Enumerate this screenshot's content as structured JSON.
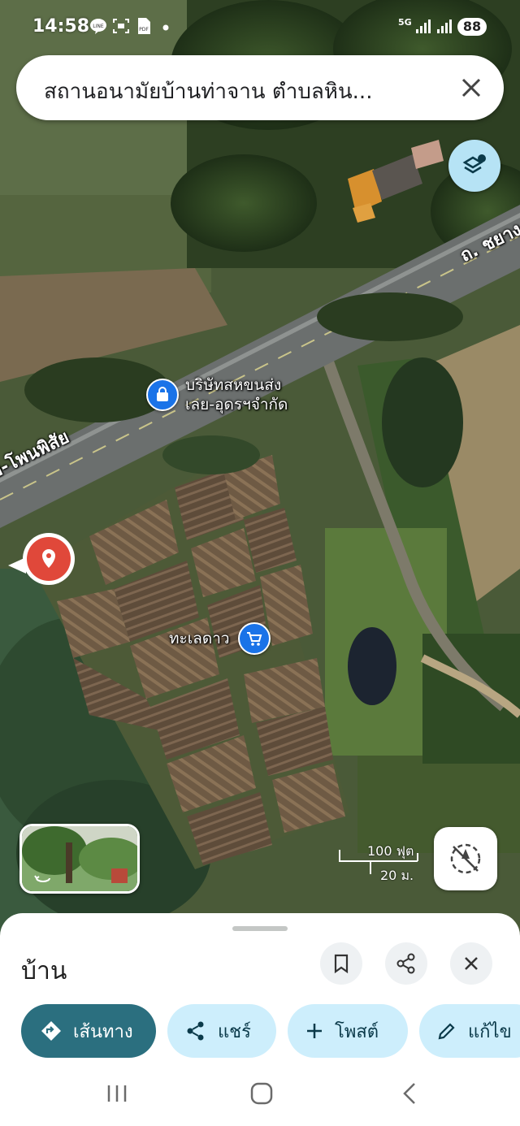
{
  "status_bar": {
    "time": "14:58",
    "network": "5G",
    "battery": "88",
    "icons": [
      "line-icon",
      "screenshot-icon",
      "pdf-icon",
      "dot-icon",
      "signal-icon",
      "signal-icon",
      "battery-icon"
    ]
  },
  "search": {
    "query": "สถานอนามัยบ้านท่าจาน ตำบลหิน..."
  },
  "map": {
    "road_label_left": "ย-โพนพิสัย",
    "road_label_right": "ถ. ชยาง",
    "places": [
      {
        "name_line1": "บริษัทสหขนส่ง",
        "name_line2": "เลย-อุดรฯจำกัด",
        "icon": "shopping-bag-icon"
      },
      {
        "name": "ทะเลดาว",
        "icon": "shopping-cart-icon"
      }
    ],
    "scale_ft": "100 ฟุต",
    "scale_m": "20 ม."
  },
  "sheet": {
    "title": "บ้าน",
    "chips": {
      "directions": "เส้นทาง",
      "share": "แชร์",
      "post": "โพสต์",
      "edit": "แก้ไข"
    }
  },
  "colors": {
    "accent": "#2b6f7f",
    "chip_bg": "#cdeefc",
    "pin_red": "#e0483a",
    "place_blue": "#1a73e8"
  }
}
